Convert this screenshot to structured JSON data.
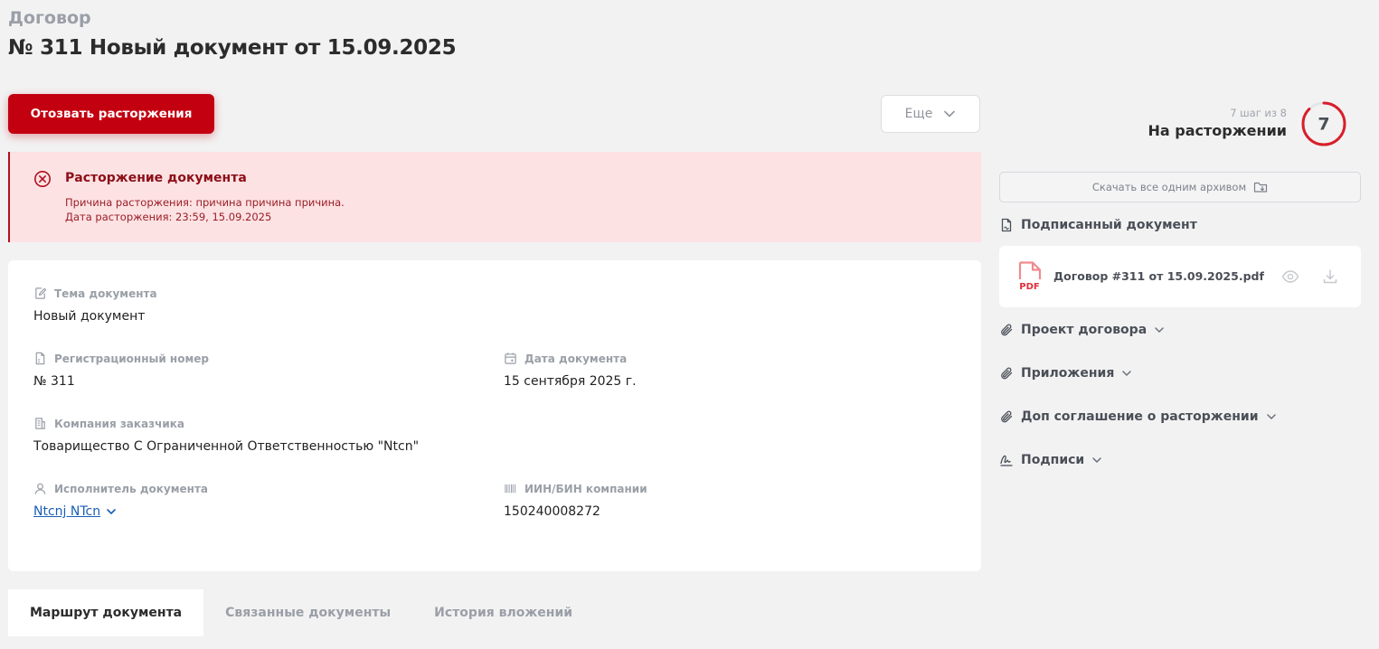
{
  "header": {
    "breadcrumb": "Договор",
    "title": "№ 311 Новый документ от 15.09.2025"
  },
  "actions": {
    "primary_label": "Отозвать расторжения",
    "more_label": "Еще"
  },
  "alert": {
    "title": "Расторжение документа",
    "reason": "Причина расторжения: причина причина причина.",
    "date": "Дата расторжения: 23:59, 15.09.2025"
  },
  "fields": {
    "topic": {
      "label": "Тема документа",
      "value": "Новый документ"
    },
    "reg_number": {
      "label": "Регистрационный номер",
      "value": "№ 311"
    },
    "doc_date": {
      "label": "Дата документа",
      "value": "15 сентября 2025 г."
    },
    "customer": {
      "label": "Компания заказчика",
      "value": "Товарищество С Ограниченной Ответственностью \"Ntcn\""
    },
    "executor": {
      "label": "Исполнитель документа",
      "value": "Ntcnj NTcn"
    },
    "bin": {
      "label": "ИИН/БИН компании",
      "value": "150240008272"
    }
  },
  "tabs": [
    {
      "label": "Маршрут документа",
      "active": true
    },
    {
      "label": "Связанные документы",
      "active": false
    },
    {
      "label": "История вложений",
      "active": false
    }
  ],
  "status": {
    "step_text": "7 шаг из 8",
    "label": "На расторжении",
    "step_number": "7",
    "progress_fraction": 0.875,
    "ring_color": "#d81f2a"
  },
  "sidebar": {
    "archive_label": "Скачать все одним архивом",
    "signed_doc_title": "Подписанный документ",
    "file": {
      "type_label": "PDF",
      "name": "Договор #311 от 15.09.2025.pdf"
    },
    "sections": [
      {
        "label": "Проект договора",
        "icon": "paperclip-icon"
      },
      {
        "label": "Приложения",
        "icon": "paperclip-icon"
      },
      {
        "label": "Доп соглашение о расторжении",
        "icon": "paperclip-icon"
      },
      {
        "label": "Подписи",
        "icon": "signature-icon"
      }
    ]
  },
  "colors": {
    "primary": "#c30010",
    "alert_bg": "#fde2e3",
    "link": "#1a5fb4"
  }
}
